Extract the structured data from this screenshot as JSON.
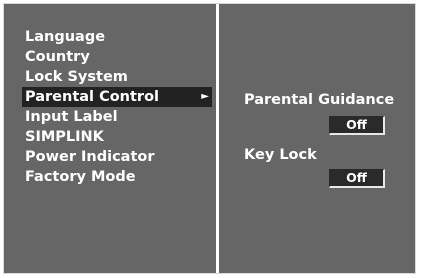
{
  "menu": {
    "items": [
      {
        "label": "Language"
      },
      {
        "label": "Country"
      },
      {
        "label": "Lock System"
      },
      {
        "label": "Parental Control",
        "selected": true
      },
      {
        "label": "Input Label"
      },
      {
        "label": "SIMPLINK"
      },
      {
        "label": "Power Indicator"
      },
      {
        "label": "Factory Mode"
      }
    ],
    "selected_arrow": "►"
  },
  "panel": {
    "parental_guidance": {
      "label": "Parental Guidance",
      "value": "Off"
    },
    "key_lock": {
      "label": "Key Lock",
      "value": "Off"
    }
  },
  "colors": {
    "background": "#666666",
    "highlight": "#222222",
    "text": "#ffffff"
  }
}
